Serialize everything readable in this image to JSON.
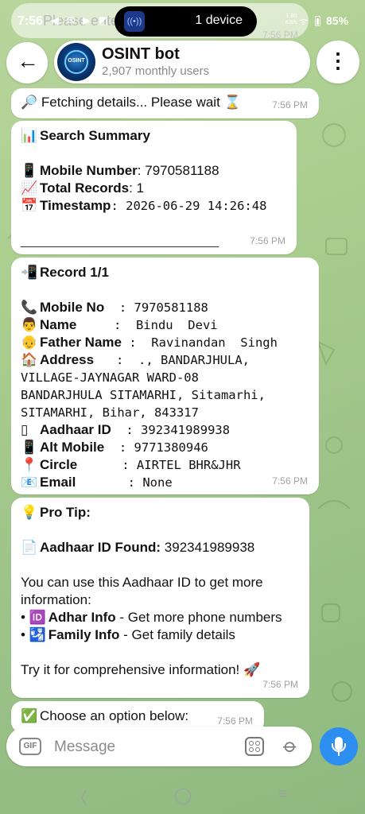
{
  "status_bar": {
    "time": "7:56",
    "notif_icons": "◀ ✉ ▶ ◩",
    "island_text": "1 device",
    "net_speed": "1.80",
    "net_unit": "KB/s",
    "battery": "85%",
    "ghost_text": "Please enter a mobile number",
    "ghost_time": "7:56 PM"
  },
  "header": {
    "bot_name": "OSINT bot",
    "subtitle": "2,907 monthly users",
    "avatar_text": "OSINT"
  },
  "messages": {
    "fetching": {
      "icon": "🔎",
      "text": "Fetching details... Please wait",
      "hourglass": "⌛",
      "time": "7:56 PM"
    },
    "summary": {
      "icon": "📊",
      "title": "Search Summary",
      "mobile_icon": "📱",
      "mobile_label": "Mobile Number",
      "mobile_value": ": 7970581188",
      "records_icon": "📈",
      "records_label": "Total Records",
      "records_value": ": 1",
      "ts_icon": "📅",
      "ts_label": "Timestamp",
      "ts_value": ": 2026-06-29 14:26:48",
      "divider": "________________________________",
      "time": "7:56 PM"
    },
    "record": {
      "icon": "📲",
      "title": "Record 1/1",
      "rows": [
        {
          "icon": "📞",
          "label": "Mobile No",
          "value": "  : 7970581188"
        },
        {
          "icon": "👨",
          "label": "Name",
          "value": "     :  Bindu  Devi"
        },
        {
          "icon": "👴",
          "label": "Father Name",
          "value": " :  Ravinandan  Singh"
        },
        {
          "icon": "🏠",
          "label": "Address",
          "value": "   :  ., BANDARJHULA,"
        }
      ],
      "address_lines": [
        "VILLAGE-JAYNAGAR WARD-08",
        "BANDARJHULA SITAMARHI, Sitamarhi,",
        "SITAMARHI, Bihar, 843317"
      ],
      "rows2": [
        {
          "icon": "▯",
          "label": "Aadhaar ID",
          "value": "  : 392341989938"
        },
        {
          "icon": "📱",
          "label": "Alt Mobile",
          "value": "  : 9771380946"
        },
        {
          "icon": "📍",
          "label": "Circle",
          "value": "      : AIRTEL BHR&JHR"
        },
        {
          "icon": "📧",
          "label": "Email",
          "value": "       : None"
        }
      ],
      "time": "7:56 PM"
    },
    "tip": {
      "icon": "💡",
      "title": "Pro Tip:",
      "found_icon": "📄",
      "found_label": "Aadhaar ID Found:",
      "found_value": "392341989938",
      "para1": "You can use this Aadhaar ID to get more",
      "para2": "information:",
      "opt1_icon": "🆔",
      "opt1_label": "Adhar Info",
      "opt1_desc": " - Get more phone numbers",
      "opt2_icon": "🛂",
      "opt2_label": "Family Info",
      "opt2_desc": " - Get family details",
      "closing": "Try it for comprehensive information!",
      "closing_icon": "🚀",
      "time": "7:56 PM"
    },
    "choose": {
      "icon": "✅",
      "text": "Choose an option below:",
      "time": "7:56 PM"
    }
  },
  "input": {
    "placeholder": "Message",
    "gif_label": "GIF"
  },
  "nav": {
    "back": "〈",
    "home": "◯",
    "recents": "≡"
  }
}
